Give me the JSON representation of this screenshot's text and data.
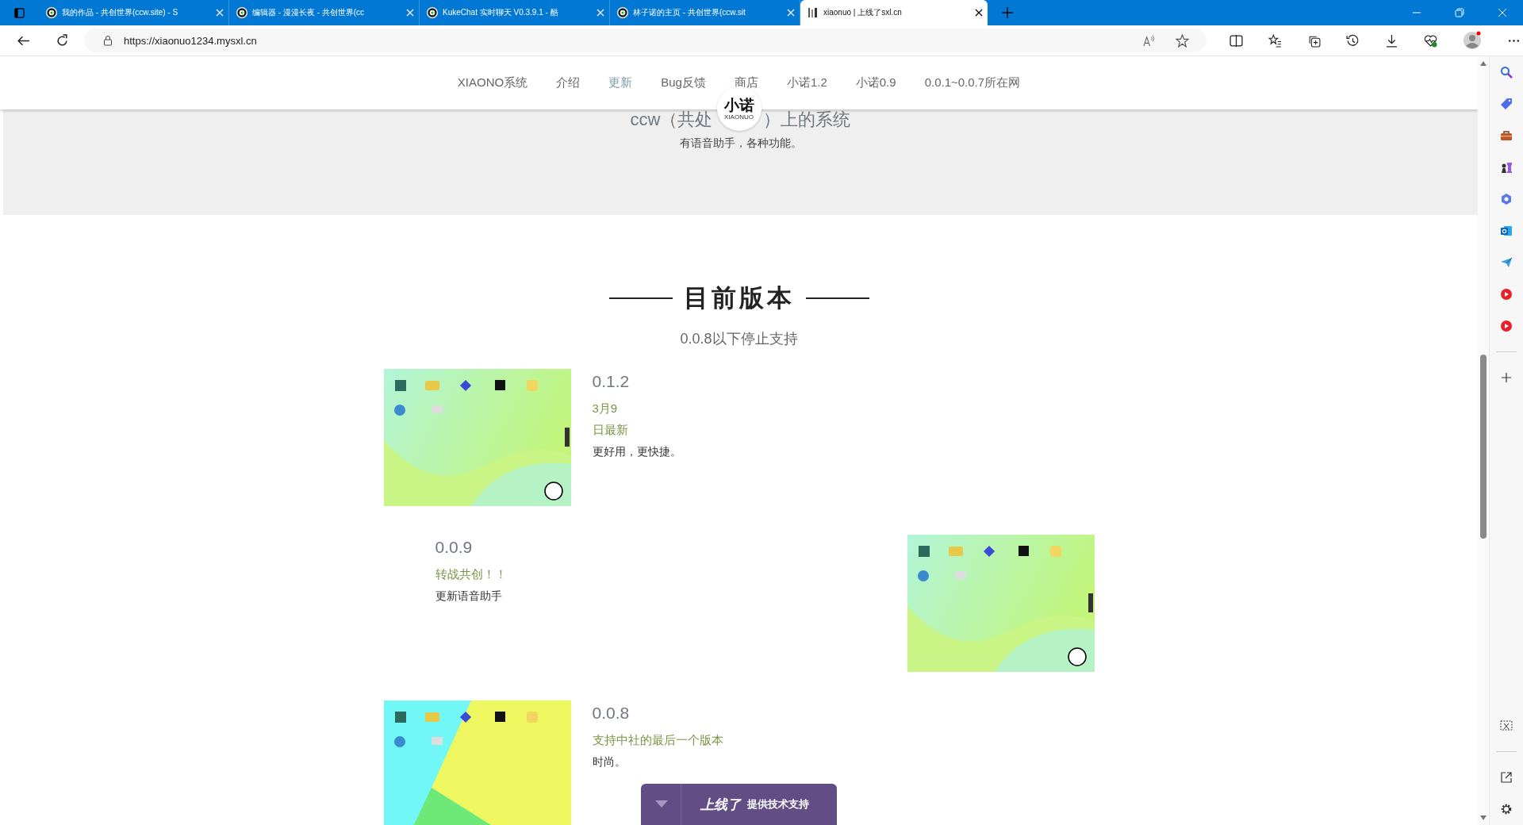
{
  "browser": {
    "tabs": [
      {
        "title": "我的作品 - 共创世界(ccw.site) - S",
        "selected": false
      },
      {
        "title": "编辑器 - 漫漫长夜 - 共创世界(cc",
        "selected": false
      },
      {
        "title": "KukeChat 实时聊天 V0.3.9.1 - 酷",
        "selected": false
      },
      {
        "title": "林子诺的主页 - 共创世界(ccw.sit",
        "selected": false
      },
      {
        "title": "xiaonuo | 上线了sxl.cn",
        "selected": true
      }
    ],
    "address": "https://xiaonuo1234.mysxl.cn"
  },
  "nav": {
    "items": [
      {
        "label": "XIAONO系统",
        "selected": false
      },
      {
        "label": "介绍",
        "selected": false
      },
      {
        "label": "更新",
        "selected": true
      },
      {
        "label": "Bug反馈",
        "selected": false
      },
      {
        "label": "商店",
        "selected": false
      },
      {
        "label": "小诺1.2",
        "selected": false
      },
      {
        "label": "小诺0.9",
        "selected": false
      },
      {
        "label": "0.0.1~0.0.7所在网",
        "selected": false
      }
    ]
  },
  "logo": {
    "name": "小诺",
    "sub": "XIAONUO"
  },
  "hero": {
    "title_left": "ccw（共处",
    "title_right": "）上的系统",
    "subtitle": "有语音助手，各种功能。"
  },
  "section": {
    "title": "目前版本",
    "subtitle": "0.0.8以下停止支持"
  },
  "versions": [
    {
      "kind": "image-left",
      "version": "0.1.2",
      "notes": [
        "3月9",
        "日最新"
      ],
      "description": "更好用，更快捷。",
      "image": {
        "kind": "picture"
      }
    },
    {
      "kind": "image-right",
      "version": "0.0.9",
      "notes": [
        "转战共创！！"
      ],
      "description": "更新语音助手",
      "image": {
        "kind": "picture"
      }
    },
    {
      "kind": "image-left",
      "version": "0.0.8",
      "notes": [
        "支持中社的最后一个版本"
      ],
      "description": "时尚。",
      "image": {
        "kind": "picture"
      }
    }
  ],
  "widget": {
    "brand": "上线了",
    "text": "提供技术支持"
  }
}
